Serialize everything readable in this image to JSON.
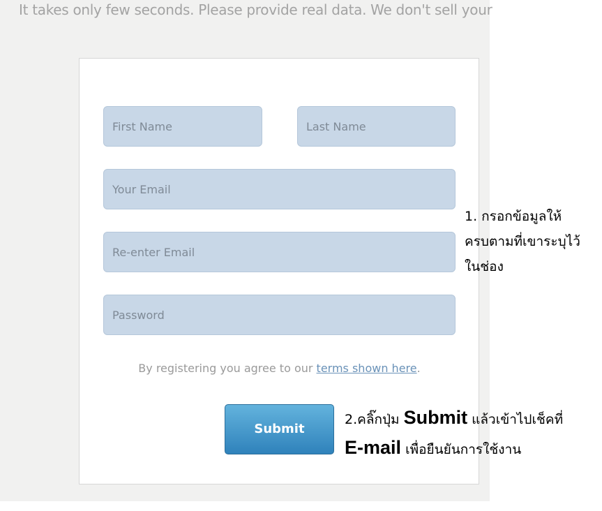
{
  "tagline": "It takes only few seconds. Please provide real data. We don't sell your",
  "form": {
    "first_name_placeholder": "First Name",
    "last_name_placeholder": "Last Name",
    "email_placeholder": "Your Email",
    "reenter_email_placeholder": "Re-enter Email",
    "password_placeholder": "Password",
    "agree_prefix": "By registering you agree to our ",
    "terms_link": "terms shown here",
    "agree_suffix": ".",
    "submit_label": "Submit"
  },
  "annotations": {
    "note1_line1": "1. กรอกข้อมูลให้",
    "note1_line2": "ครบตามที่เขาระบุไว้",
    "note1_line3": "ในช่อง",
    "note2_prefix": "2.คลิ๊กปุ่ม ",
    "note2_submit": "Submit",
    "note2_middle": " แล้วเข้าไปเช็คที่",
    "note2_email": "E-mail",
    "note2_suffix": " เพื่อยืนยันการใช้งาน"
  },
  "colors": {
    "field_bg": "#c8d7e7",
    "button_top": "#63b3dd",
    "button_bottom": "#2f82bb",
    "link": "#6a92b8"
  }
}
